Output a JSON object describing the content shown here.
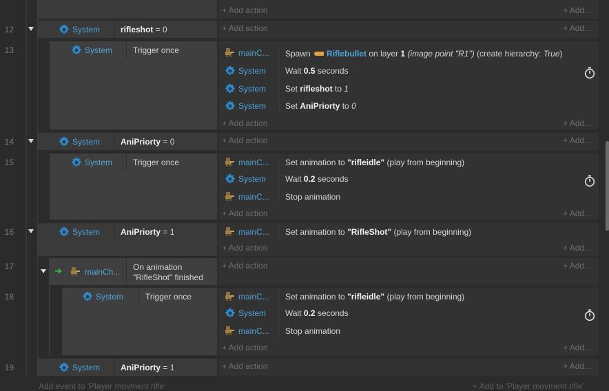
{
  "row_numbers": [
    "12",
    "13",
    "14",
    "15",
    "16",
    "17",
    "18",
    "19"
  ],
  "common": {
    "add_action": "Add action",
    "add_more": "Add..."
  },
  "events": {
    "e12": {
      "object": "System",
      "cond_name": "rifleshot",
      "cond_op": " = 0"
    },
    "e13": {
      "object": "System",
      "condition": "Trigger once",
      "actions": [
        {
          "object": "mainC...",
          "pre": "Spawn ",
          "inst": "Riflebullet",
          "mid": " on layer ",
          "layer": "1",
          "paren": " (image point \"R1\")",
          "tail": " (create hierarchy: ",
          "tail_val": "True",
          "tail_end": ")"
        },
        {
          "object": "System",
          "pre": "Wait ",
          "bold": "0.5",
          "post": " seconds"
        },
        {
          "object": "System",
          "pre": "Set ",
          "bold": "rifleshot",
          "post": " to ",
          "italic": "1"
        },
        {
          "object": "System",
          "pre": "Set ",
          "bold": "AniPriorty",
          "post": " to ",
          "italic": "0"
        }
      ]
    },
    "e14": {
      "object": "System",
      "cond_name": "AniPriorty",
      "cond_op": " = 0"
    },
    "e15": {
      "object": "System",
      "condition": "Trigger once",
      "actions": [
        {
          "object": "mainC...",
          "pre": "Set animation to ",
          "bold": "\"rifleidle\"",
          "post": " (play from beginning)"
        },
        {
          "object": "System",
          "pre": "Wait ",
          "bold": "0.2",
          "post": " seconds"
        },
        {
          "object": "mainC...",
          "text": "Stop animation"
        }
      ]
    },
    "e16": {
      "object": "System",
      "cond_name": "AniPriorty",
      "cond_op": " = 1",
      "actions": [
        {
          "object": "mainC...",
          "pre": "Set animation to ",
          "bold": "\"RifleShot\"",
          "post": " (play from beginning)"
        }
      ]
    },
    "e17": {
      "object": "mainCh...",
      "line1": "On animation",
      "line2": "\"RifleShot\" finished"
    },
    "e18": {
      "object": "System",
      "condition": "Trigger once",
      "actions": [
        {
          "object": "mainC...",
          "pre": "Set animation to ",
          "bold": "\"rifleidle\"",
          "post": " (play from beginning)"
        },
        {
          "object": "System",
          "pre": "Wait ",
          "bold": "0.2",
          "post": " seconds"
        },
        {
          "object": "mainC...",
          "text": "Stop animation"
        }
      ]
    },
    "e19": {
      "object": "System",
      "cond_name": "AniPriorty",
      "cond_op": " = 1"
    }
  },
  "footer": {
    "add_event": "Add event to 'Player movment rifle'",
    "add_to": "Add to 'Player movment rifle'"
  },
  "colors": {
    "object_blue": "#4fa3d9",
    "trigger_green": "#2ecc40",
    "bg": "#2b2b2b"
  },
  "icons": {
    "system": "gear-icon",
    "sprite": "sprite-icon",
    "timer": "stopwatch-icon",
    "trigger": "green-arrow-icon",
    "collapse": "collapse-arrow-icon"
  }
}
